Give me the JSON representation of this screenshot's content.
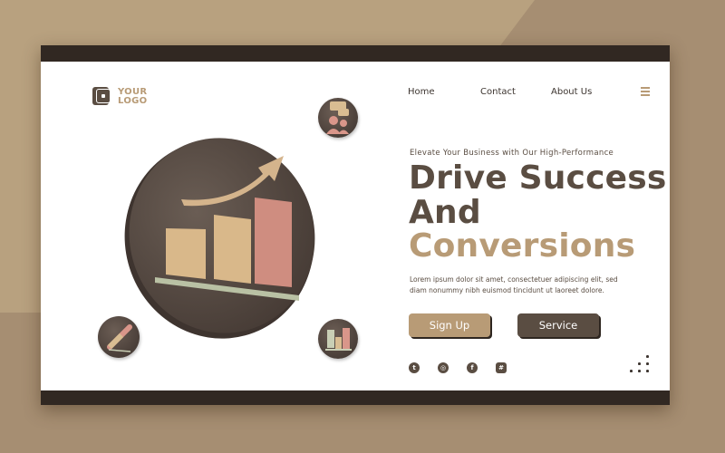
{
  "logo": {
    "line1": "YOUR",
    "line2": "LOGO"
  },
  "nav": {
    "items": [
      {
        "label": "Home"
      },
      {
        "label": "Contact"
      },
      {
        "label": "About Us"
      }
    ],
    "menu_icon": "hamburger-menu-icon"
  },
  "hero": {
    "eyebrow": "Elevate Your Business with Our High-Performance",
    "title_line1": "Drive Success",
    "title_line2": "And",
    "title_line3": "Conversions",
    "paragraph": "Lorem ipsum dolor sit amet, consectetuer adipiscing elit, sed diam nonummy nibh euismod tincidunt ut laoreet dolore.",
    "primary_button": "Sign Up",
    "secondary_button": "Service"
  },
  "social": [
    {
      "icon": "twitter-icon",
      "glyph": "t"
    },
    {
      "icon": "instagram-icon",
      "glyph": "◎"
    },
    {
      "icon": "facebook-icon",
      "glyph": "f"
    },
    {
      "icon": "dribbble-icon",
      "glyph": "#"
    }
  ],
  "illustration": {
    "main": "growth-chart-illustration",
    "badges": [
      "team-chat-icon",
      "pencil-icon",
      "bar-chart-icon"
    ]
  },
  "colors": {
    "primary_dark": "#5a4d42",
    "accent_tan": "#b89b76",
    "frame_bar": "#312822",
    "background": "#b8a17f",
    "background_shade": "#a68e72"
  }
}
